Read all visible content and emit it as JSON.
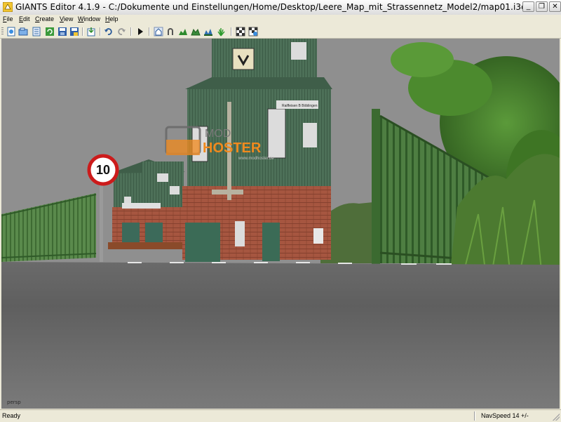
{
  "window": {
    "title": "GIANTS Editor 4.1.9 - C:/Dokumente und Einstellungen/Home/Desktop/Leere_Map_mit_Strassennetz_Model2/map01.i3d",
    "minimize_glyph": "_",
    "restore_glyph": "❐",
    "close_glyph": "✕",
    "icon": "giants-app-icon"
  },
  "menu": {
    "items": [
      {
        "label": "File",
        "key": "F",
        "rest": "ile"
      },
      {
        "label": "Edit",
        "key": "E",
        "rest": "dit"
      },
      {
        "label": "Create",
        "key": "C",
        "rest": "reate"
      },
      {
        "label": "View",
        "key": "V",
        "rest": "iew"
      },
      {
        "label": "Window",
        "key": "W",
        "rest": "indow"
      },
      {
        "label": "Help",
        "key": "H",
        "rest": "elp"
      }
    ]
  },
  "toolbar": {
    "icons": [
      "new-file-icon",
      "open-file-icon",
      "scene-list-icon",
      "refresh-icon",
      "save-icon",
      "save-as-icon",
      "import-icon",
      "undo-icon",
      "redo-icon",
      "play-icon",
      "home-icon",
      "magnet-icon",
      "terrain-paint-icon",
      "terrain-sculpt-icon",
      "terrain-smooth-icon",
      "foliage-icon",
      "checker-icon",
      "checker-edit-icon"
    ]
  },
  "viewport": {
    "camera_label": "persp",
    "speed_sign_value": "10",
    "watermark_top": "MOD",
    "watermark_bottom": "HOSTER",
    "watermark_url": "www.modhoster.de",
    "building_sign_text": "Raiffeisen B Böblingen"
  },
  "status": {
    "left": "Ready",
    "right": "NavSpeed 14 +/-"
  },
  "colors": {
    "titlebar": "#e8e8e8",
    "sky": "#8e8e8e",
    "road": "#606060",
    "fence": "#44703a",
    "building_green": "#4b6d55",
    "brick": "#a8553e",
    "watermark_orange": "#f08a1e"
  }
}
